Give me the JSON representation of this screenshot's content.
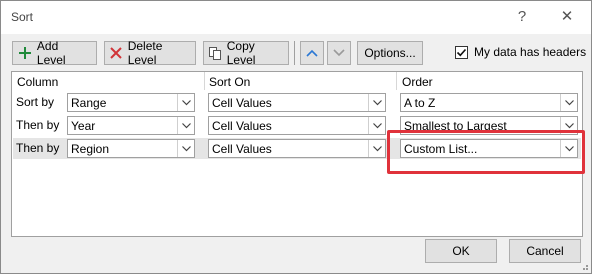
{
  "window": {
    "title": "Sort",
    "help_glyph": "?",
    "close_glyph": "✕"
  },
  "toolbar": {
    "add_level": "Add Level",
    "delete_level": "Delete Level",
    "copy_level": "Copy Level",
    "options": "Options...",
    "headers_checkbox_label": "My data has headers",
    "headers_checked": true
  },
  "columns": {
    "column": "Column",
    "sort_on": "Sort On",
    "order": "Order"
  },
  "rows": [
    {
      "label": "Sort by",
      "column": "Range",
      "sort_on": "Cell Values",
      "order": "A to Z"
    },
    {
      "label": "Then by",
      "column": "Year",
      "sort_on": "Cell Values",
      "order": "Smallest to Largest"
    },
    {
      "label": "Then by",
      "column": "Region",
      "sort_on": "Cell Values",
      "order": "Custom List..."
    }
  ],
  "footer": {
    "ok": "OK",
    "cancel": "Cancel"
  },
  "colors": {
    "highlight": "#e0323b",
    "add_green": "#1f8a3a",
    "delete_red": "#d13438",
    "arrow_blue": "#2b78d4"
  },
  "icons": {
    "add": "plus-icon",
    "delete": "x-icon",
    "copy": "copy-icon",
    "up": "chevron-up-icon",
    "down": "chevron-down-icon",
    "dropdown": "chevron-down-icon",
    "check": "checkmark-icon"
  }
}
